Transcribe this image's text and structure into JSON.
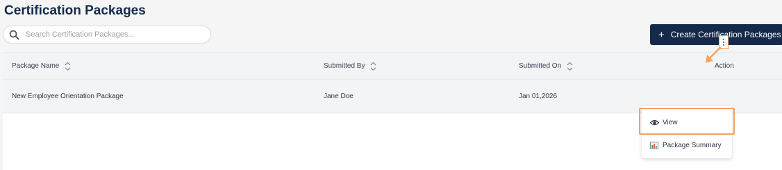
{
  "page": {
    "title": "Certification Packages"
  },
  "search": {
    "placeholder": "Search Certification Packages..."
  },
  "toolbar": {
    "create_label": "Create Certification Packages",
    "create_icon": "plus-icon"
  },
  "table": {
    "columns": [
      {
        "label": "Package Name",
        "sortable": true
      },
      {
        "label": "Submitted By",
        "sortable": true
      },
      {
        "label": "Submitted On",
        "sortable": true
      },
      {
        "label": "Action",
        "sortable": false
      }
    ],
    "rows": [
      {
        "package_name": "New Employee Orientation Package",
        "submitted_by": "Jane Doe",
        "submitted_on": "Jan 01,2026"
      }
    ]
  },
  "action_menu": {
    "items": [
      {
        "label": "View",
        "icon": "eye-icon",
        "highlighted": true
      },
      {
        "label": "Package Summary",
        "icon": "bar-chart-icon",
        "highlighted": false
      }
    ]
  },
  "colors": {
    "brand": "#152a4a",
    "highlight": "#f4a261"
  }
}
